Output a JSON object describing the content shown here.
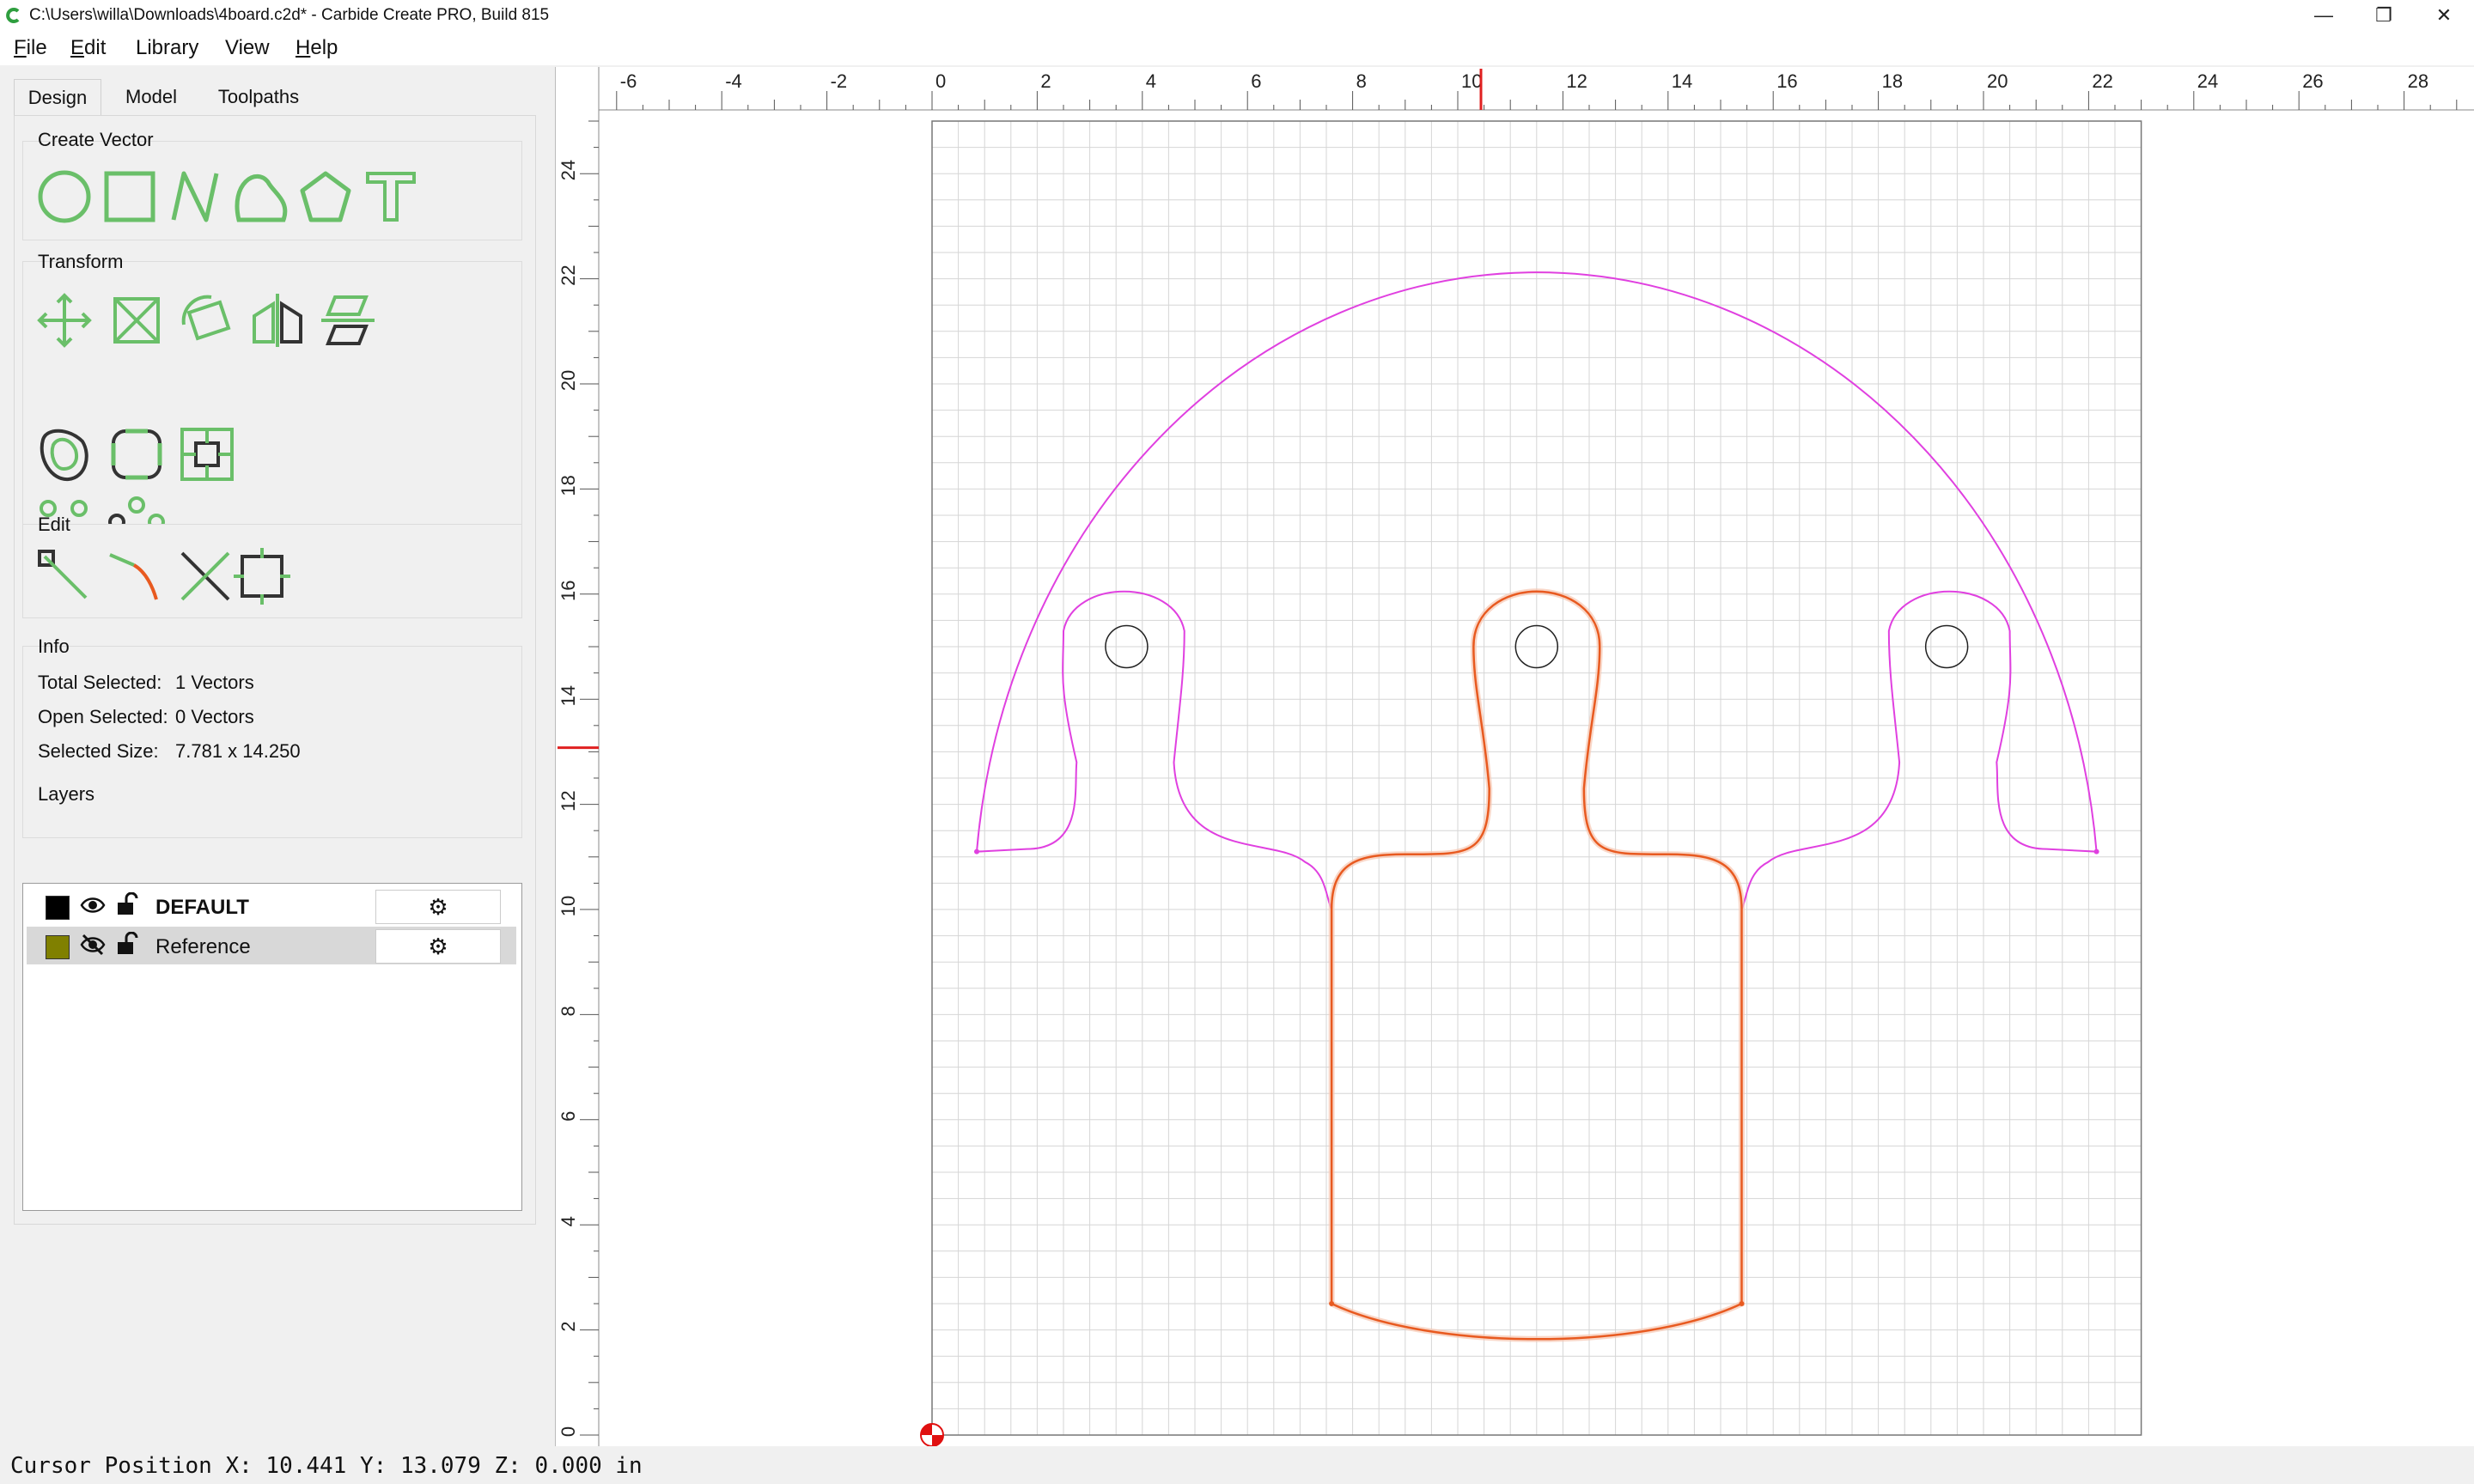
{
  "window": {
    "title": "C:\\Users\\willa\\Downloads\\4board.c2d* - Carbide Create PRO, Build 815",
    "minimize": "—",
    "restore": "❐",
    "close": "✕"
  },
  "menu": {
    "file": {
      "u": "F",
      "rest": "ile"
    },
    "edit": {
      "u": "E",
      "rest": "dit"
    },
    "library": "Library",
    "view": "View",
    "help": {
      "u": "H",
      "rest": "elp"
    }
  },
  "tabs": [
    "Design",
    "Model",
    "Toolpaths"
  ],
  "sections": {
    "create_vector": "Create Vector",
    "transform": "Transform",
    "edit": "Edit",
    "info": "Info",
    "layers": "Layers"
  },
  "info": {
    "total_selected_label": "Total Selected:",
    "total_selected_value": "1 Vectors",
    "open_selected_label": "Open Selected:",
    "open_selected_value": "0 Vectors",
    "selected_size_label": "Selected Size:",
    "selected_size_value": "7.781 x 14.250"
  },
  "layers": [
    {
      "name": "DEFAULT",
      "color": "#000000",
      "visible": true,
      "locked": false,
      "bold": true
    },
    {
      "name": "Reference",
      "color": "#808000",
      "visible": false,
      "locked": false,
      "bold": false
    }
  ],
  "icons": {
    "gear": "⚙",
    "visible": "eye-icon",
    "hidden": "eye-off-icon",
    "lock": "unlock-icon"
  },
  "ruler": {
    "x_labels": [
      "-6",
      "-4",
      "-2",
      "0",
      "2",
      "4",
      "6",
      "8",
      "10",
      "12",
      "14",
      "16",
      "18",
      "20",
      "22",
      "24",
      "26",
      "28"
    ],
    "y_labels": [
      "0",
      "2",
      "4",
      "6",
      "8",
      "10",
      "12",
      "14",
      "16",
      "18",
      "20",
      "22",
      "24"
    ]
  },
  "cursor": {
    "x": 10.441,
    "y": 13.079
  },
  "status": "Cursor Position X: 10.441 Y: 13.079 Z: 0.000 in",
  "colors": {
    "accent_green": "#6abf69",
    "magenta": "#e040e0",
    "selected_orange": "#e85a20",
    "ruler_red": "#e02020",
    "grid": "#d6d6d6"
  }
}
